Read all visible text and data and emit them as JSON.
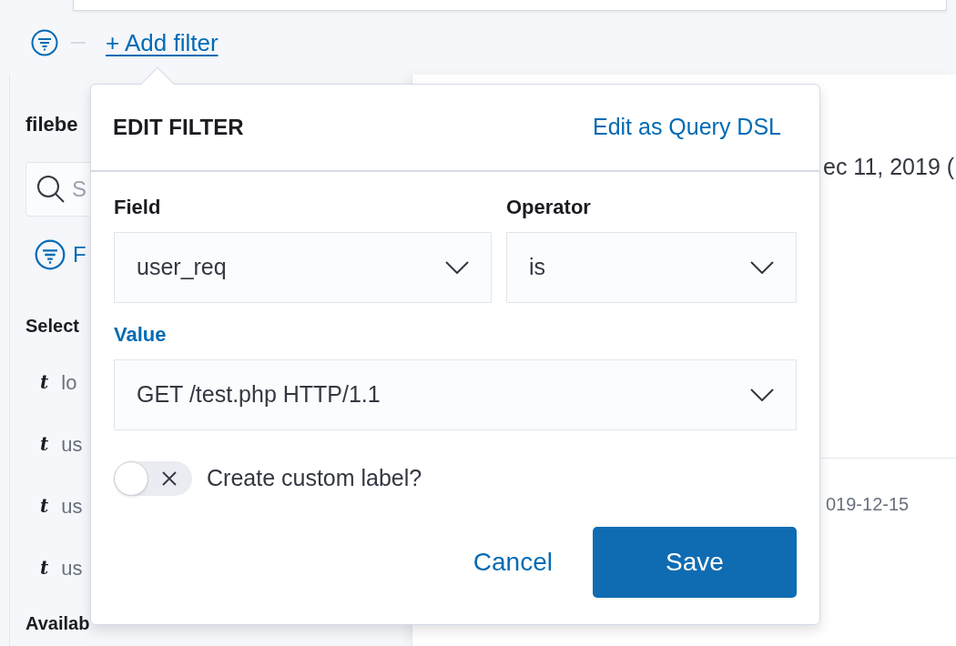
{
  "filter_bar": {
    "add_filter": "+ Add filter"
  },
  "sidebar": {
    "index_pattern": "filebe",
    "search": {
      "placeholder": "S"
    },
    "filter_toggle": "F",
    "selected_heading": "Select",
    "selected_fields": [
      {
        "type": "t",
        "name": "lo"
      },
      {
        "type": "t",
        "name": "us"
      },
      {
        "type": "t",
        "name": "us"
      },
      {
        "type": "t",
        "name": "us"
      }
    ],
    "available_heading": "Availab"
  },
  "content": {
    "date_range": "ec 11, 2019 (",
    "row_date": "019-12-15"
  },
  "popover": {
    "title": "EDIT FILTER",
    "dsl_link": "Edit as Query DSL",
    "field": {
      "label": "Field",
      "value": "user_req",
      "focused": false
    },
    "operator": {
      "label": "Operator",
      "value": "is",
      "focused": false
    },
    "value": {
      "label": "Value",
      "value": "GET /test.php HTTP/1.1",
      "focused": true
    },
    "custom_label": {
      "label": "Create custom label?",
      "on": false
    },
    "buttons": [
      {
        "label": "Cancel",
        "kind": "link"
      },
      {
        "label": "Save",
        "kind": "primary"
      }
    ]
  }
}
